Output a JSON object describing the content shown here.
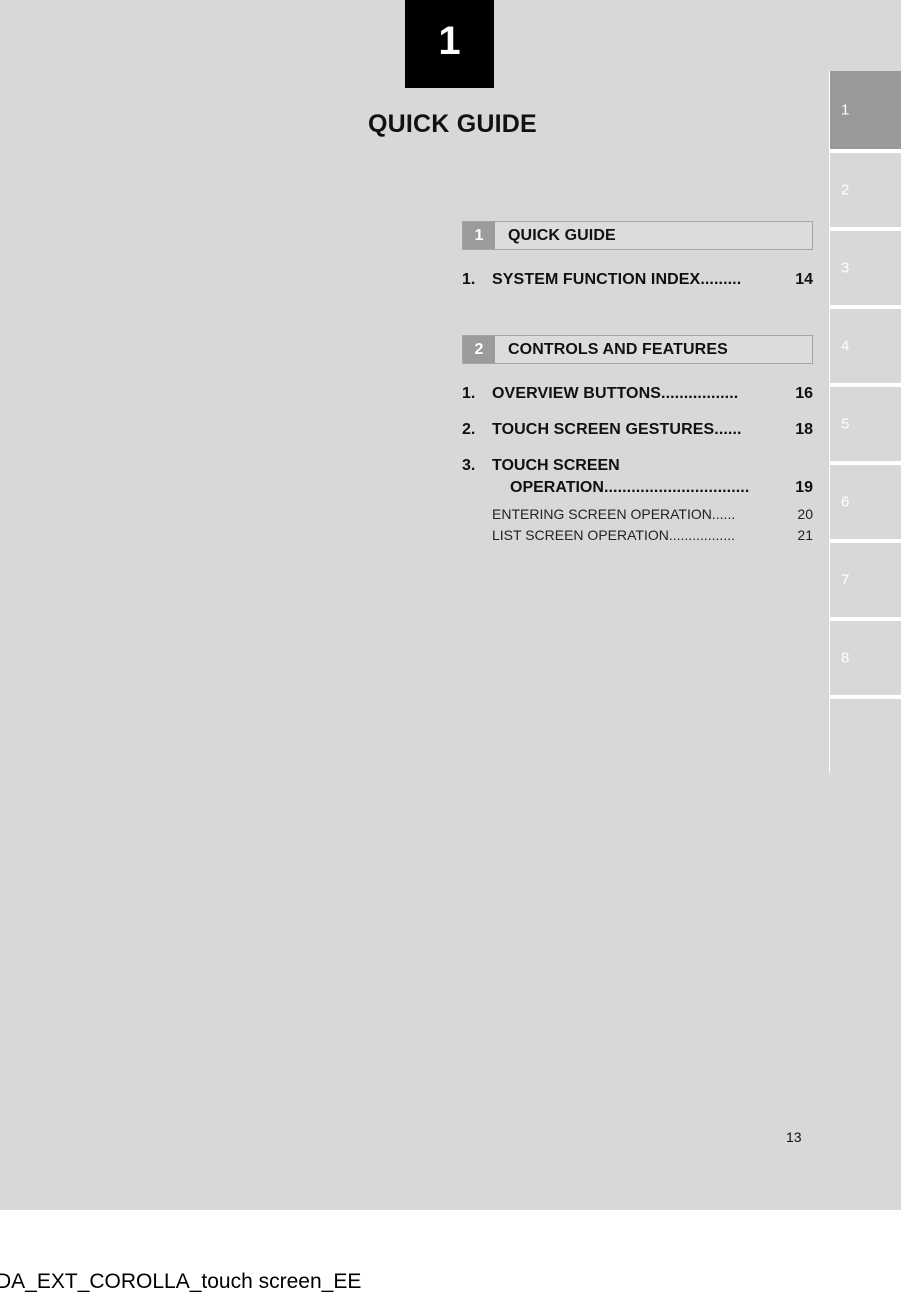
{
  "document": {
    "chapter_number": "1",
    "chapter_title": "QUICK GUIDE",
    "page_number": "13",
    "footer_code": "DA_EXT_COROLLA_touch screen_EE"
  },
  "toc": {
    "sections": [
      {
        "number": "1",
        "name": "QUICK GUIDE",
        "entries": [
          {
            "number": "1.",
            "title": "SYSTEM FUNCTION INDEX",
            "leader": ".........",
            "page": "14",
            "subentries": []
          }
        ]
      },
      {
        "number": "2",
        "name": "CONTROLS AND FEATURES",
        "entries": [
          {
            "number": "1.",
            "title": "OVERVIEW BUTTONS",
            "leader": " .................",
            "page": "16",
            "subentries": []
          },
          {
            "number": "2.",
            "title": "TOUCH SCREEN GESTURES",
            "leader": "......",
            "page": "18",
            "subentries": []
          },
          {
            "number": "3.",
            "title_line1": "TOUCH SCREEN",
            "title_line2": "OPERATION",
            "leader": "................................",
            "page": "19",
            "subentries": [
              {
                "title": "ENTERING SCREEN OPERATION",
                "leader": "......",
                "page": "20"
              },
              {
                "title": "LIST SCREEN OPERATION",
                "leader": ".................",
                "page": "21"
              }
            ]
          }
        ]
      }
    ]
  },
  "tab_strip": {
    "tabs": [
      {
        "label": "1",
        "active": true
      },
      {
        "label": "2",
        "active": false
      },
      {
        "label": "3",
        "active": false
      },
      {
        "label": "4",
        "active": false
      },
      {
        "label": "5",
        "active": false
      },
      {
        "label": "6",
        "active": false
      },
      {
        "label": "7",
        "active": false
      },
      {
        "label": "8",
        "active": false
      },
      {
        "label": "",
        "active": false
      }
    ]
  },
  "colors": {
    "page_background": "#d8d8d8",
    "badge_background": "#000000",
    "section_number_background": "#9b9b9b",
    "section_header_background": "#dcdcdc",
    "active_tab": "#999999"
  }
}
